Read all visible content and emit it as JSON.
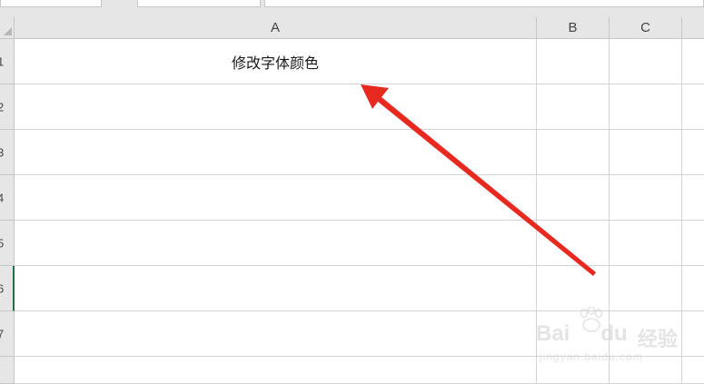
{
  "columns": [
    "A",
    "B",
    "C"
  ],
  "rows": [
    "1",
    "2",
    "3",
    "4",
    "5",
    "6",
    "7"
  ],
  "active_row": "6",
  "cells": {
    "A1": "修改字体颜色"
  },
  "annotation": {
    "color": "#e8291f",
    "icon": "arrow-icon"
  },
  "watermark": {
    "brand": "Bai",
    "brand2": "du",
    "sub": "经验",
    "url": "jingyan.baidu.com"
  }
}
